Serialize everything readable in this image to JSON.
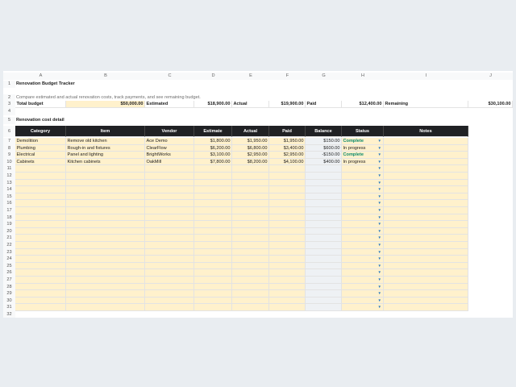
{
  "columns": [
    "A",
    "B",
    "C",
    "D",
    "E",
    "F",
    "G",
    "H",
    "I",
    "J"
  ],
  "title": "Renovation Budget Tracker",
  "subtitle": "Compare estimated and actual renovation costs, track payments, and see remaining budget.",
  "summary": {
    "total_budget_label": "Total budget",
    "total_budget_value": "$50,000.00",
    "estimated_label": "Estimated",
    "estimated_value": "$18,900.00",
    "actual_label": "Actual",
    "actual_value": "$19,900.00",
    "paid_label": "Paid",
    "paid_value": "$12,400.00",
    "remaining_label": "Remaining",
    "remaining_value": "$30,100.00"
  },
  "section_title": "Renovation cost detail",
  "table_headers": [
    "Category",
    "Item",
    "Vendor",
    "Estimate",
    "Actual",
    "Paid",
    "Balance",
    "Status",
    "Notes"
  ],
  "rows": [
    {
      "category": "Demolition",
      "item": "Remove old kitchen",
      "vendor": "Ace Demo",
      "estimate": "$1,800.00",
      "actual": "$1,950.00",
      "paid": "$1,950.00",
      "balance": "$150.00",
      "status": "Complete"
    },
    {
      "category": "Plumbing",
      "item": "Rough-in and fixtures",
      "vendor": "ClearFlow",
      "estimate": "$6,200.00",
      "actual": "$6,800.00",
      "paid": "$3,400.00",
      "balance": "$600.00",
      "status": "In progress"
    },
    {
      "category": "Electrical",
      "item": "Panel and lighting",
      "vendor": "BrightWorks",
      "estimate": "$3,100.00",
      "actual": "$2,950.00",
      "paid": "$2,950.00",
      "balance": "-$150.00",
      "status": "Complete"
    },
    {
      "category": "Cabinets",
      "item": "Kitchen cabinets",
      "vendor": "OakMill",
      "estimate": "$7,800.00",
      "actual": "$8,200.00",
      "paid": "$4,100.00",
      "balance": "$400.00",
      "status": "In progress"
    }
  ],
  "last_row_number": 32,
  "icons": {
    "dropdown": "chevron-down-icon"
  },
  "colors": {
    "header_bg": "#202124",
    "input_yellow": "#fff1cc",
    "complete_green": "#0a8a6a",
    "dropdown_blue": "#2d7cc1"
  }
}
